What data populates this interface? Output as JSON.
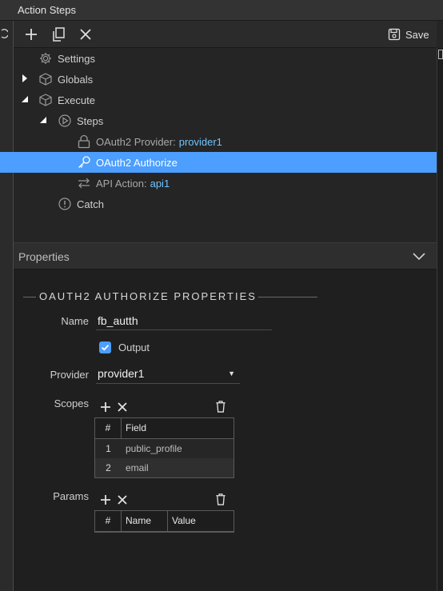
{
  "window": {
    "title": "Action Steps"
  },
  "toolbar": {
    "save_label": "Save"
  },
  "tree": {
    "settings": "Settings",
    "globals": "Globals",
    "execute": "Execute",
    "steps": "Steps",
    "oauth_provider": {
      "label": "OAuth2 Provider:",
      "value": "provider1"
    },
    "oauth_authorize": "OAuth2 Authorize",
    "api_action": {
      "label": "API Action:",
      "value": "api1"
    },
    "catch": "Catch"
  },
  "properties": {
    "header": "Properties",
    "section_title": "OAUTH2 AUTHORIZE PROPERTIES",
    "name_label": "Name",
    "name_value": "fb_autth",
    "output_label": "Output",
    "output_checked": true,
    "provider_label": "Provider",
    "provider_value": "provider1",
    "scopes_label": "Scopes",
    "scopes_columns": [
      "#",
      "Field"
    ],
    "scopes_rows": [
      {
        "num": "1",
        "field": "public_profile"
      },
      {
        "num": "2",
        "field": "email"
      }
    ],
    "params_label": "Params",
    "params_columns": [
      "#",
      "Name",
      "Value"
    ]
  },
  "colors": {
    "accent": "#4c9eff",
    "link_value": "#6fc3ff",
    "background": "#252525"
  }
}
